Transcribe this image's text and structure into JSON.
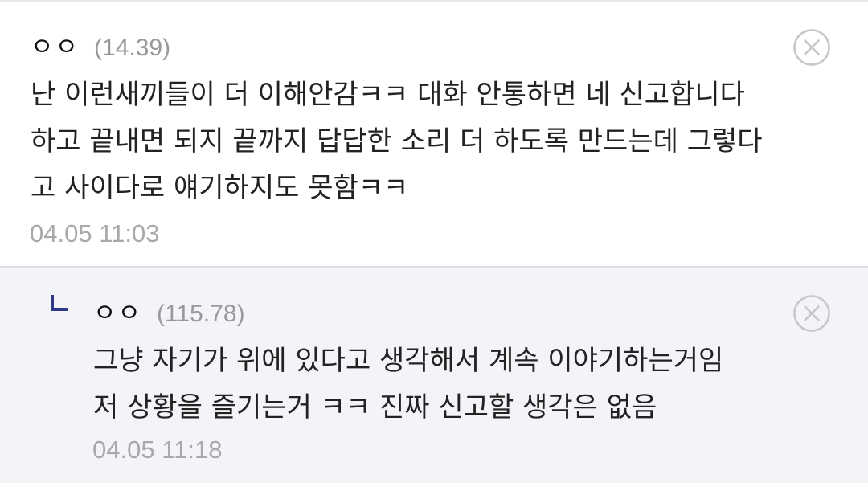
{
  "comments": [
    {
      "nickname": "ㅇㅇ",
      "ip": "(14.39)",
      "lines": [
        "난 이런새끼들이 더 이해안감ㅋㅋ 대화 안통하면 네 신고합니다",
        "하고 끝내면 되지 끝까지 답답한 소리 더 하도록 만드는데 그렇다",
        "고 사이다로 얘기하지도 못함ㅋㅋ"
      ],
      "timestamp": "04.05 11:03",
      "close_icon": "circle-x-icon"
    }
  ],
  "replies": [
    {
      "nickname": "ㅇㅇ",
      "ip": "(115.78)",
      "lines": [
        "그냥 자기가 위에 있다고 생각해서 계속 이야기하는거임",
        "저 상황을 즐기는거 ㅋㅋ 진짜 신고할 생각은 없음"
      ],
      "timestamp": "04.05 11:18",
      "reply_icon": "reply-arrow-icon",
      "close_icon": "circle-x-icon"
    }
  ],
  "colors": {
    "nickname": "#111111",
    "ip": "#999999",
    "body_text": "#222222",
    "timestamp": "#a9a9a9",
    "reply_background": "#f3f4f8",
    "divider": "#dcdde5",
    "reply_mark": "#2e3a87",
    "close_icon": "#c7c7c7"
  }
}
